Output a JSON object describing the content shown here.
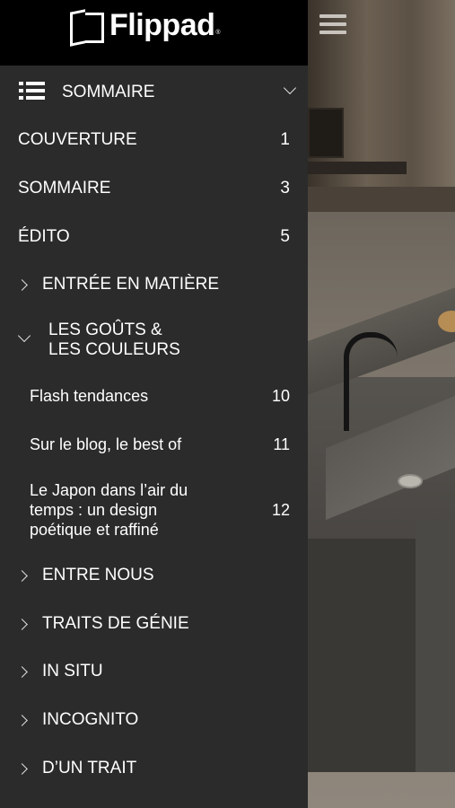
{
  "header": {
    "logo_text": "Flippad",
    "logo_reg": "®"
  },
  "menu": {
    "title": "SOMMAIRE",
    "items": [
      {
        "label": "COUVERTURE",
        "page": "1"
      },
      {
        "label": "SOMMAIRE",
        "page": "3"
      },
      {
        "label": "ÉDITO",
        "page": "5"
      },
      {
        "label": "ENTRÉE EN MATIÈRE"
      },
      {
        "label_line1": "LES GOÛTS &",
        "label_line2": "LES COULEURS"
      },
      {
        "label": "Flash tendances",
        "page": "10"
      },
      {
        "label": "Sur le blog, le best of",
        "page": "11"
      },
      {
        "label_line1": "Le Japon dans l’air du",
        "label_line2": "temps : un design",
        "label_line3": "poétique et raffiné",
        "page": "12"
      },
      {
        "label": "ENTRE NOUS"
      },
      {
        "label": "TRAITS DE GÉNIE"
      },
      {
        "label": "IN SITU"
      },
      {
        "label": "INCOGNITO"
      },
      {
        "label": "D’UN TRAIT"
      }
    ]
  }
}
